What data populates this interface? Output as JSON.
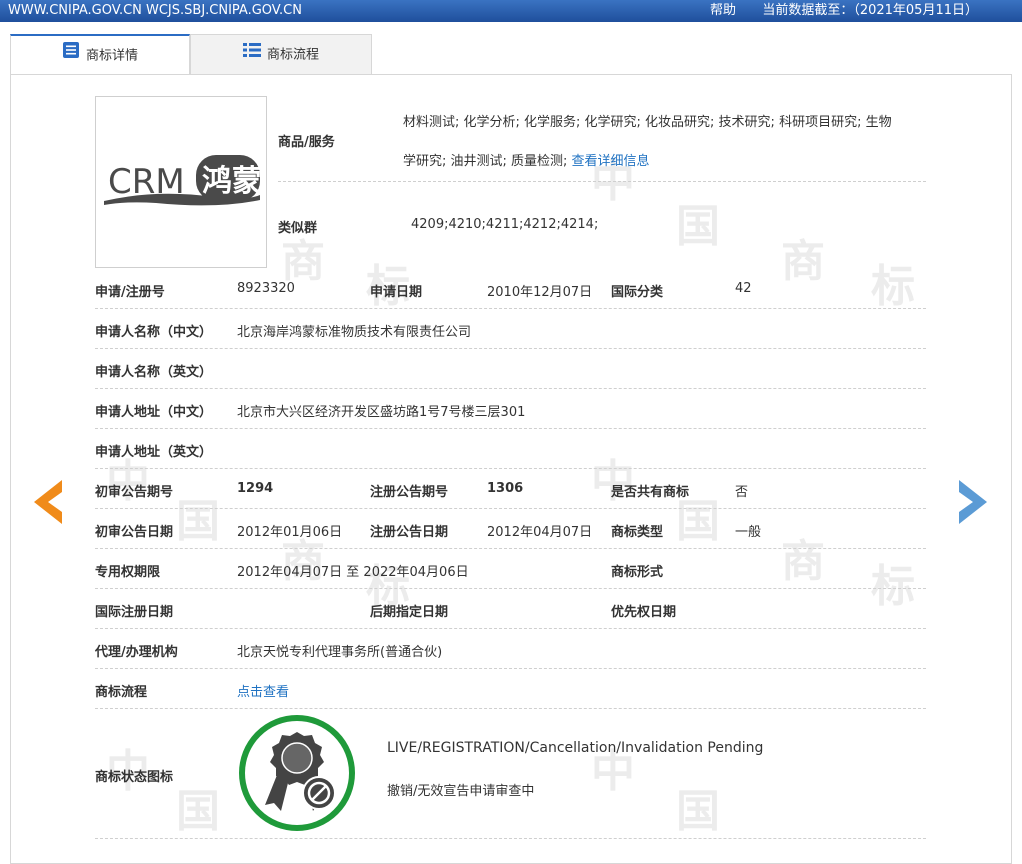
{
  "topbar": {
    "site": "WWW.CNIPA.GOV.CN WCJS.SBJ.CNIPA.GOV.CN",
    "help": "帮助",
    "data_date": "当前数据截至：（2021年05月11日）"
  },
  "tabs": [
    {
      "label": "商标详情",
      "icon": "list-icon",
      "active": true
    },
    {
      "label": "商标流程",
      "icon": "grid-list-icon",
      "active": false
    }
  ],
  "logo": {
    "text_latin": "CRM",
    "text_cn": "鸿蒙"
  },
  "goods": {
    "label": "商品/服务",
    "line1": "材料测试; 化学分析; 化学服务; 化学研究; 化妆品研究; 技术研究; 科研项目研究; 生物",
    "line2": "学研究; 油井测试; 质量检测;",
    "detail_link": "查看详细信息"
  },
  "similar": {
    "label": "类似群",
    "value": "4209;4210;4211;4212;4214;"
  },
  "rows": {
    "reg_no_label": "申请/注册号",
    "reg_no": "8923320",
    "app_date_label": "申请日期",
    "app_date": "2010年12月07日",
    "intl_class_label": "国际分类",
    "intl_class": "42",
    "applicant_cn_label": "申请人名称（中文）",
    "applicant_cn": "北京海岸鸿蒙标准物质技术有限责任公司",
    "applicant_en_label": "申请人名称（英文）",
    "address_cn_label": "申请人地址（中文）",
    "address_cn": "北京市大兴区经济开发区盛坊路1号7号楼三层301",
    "address_en_label": "申请人地址（英文）",
    "prelim_no_label": "初审公告期号",
    "prelim_no": "1294",
    "reg_pub_no_label": "注册公告期号",
    "reg_pub_no": "1306",
    "shared_label": "是否共有商标",
    "shared": "否",
    "prelim_date_label": "初审公告日期",
    "prelim_date": "2012年01月06日",
    "reg_pub_date_label": "注册公告日期",
    "reg_pub_date": "2012年04月07日",
    "mark_type_label": "商标类型",
    "mark_type": "一般",
    "term_label": "专用权期限",
    "term": "2012年04月07日 至 2022年04月06日",
    "mark_form_label": "商标形式",
    "intl_reg_date_label": "国际注册日期",
    "later_designation_label": "后期指定日期",
    "priority_date_label": "优先权日期",
    "agent_label": "代理/办理机构",
    "agent": "北京天悦专利代理事务所(普通合伙)",
    "process_label": "商标流程",
    "process_link": "点击查看",
    "status_label": "商标状态图标",
    "status_en": "LIVE/REGISTRATION/Cancellation/Invalidation Pending",
    "status_cn": "撤销/无效宣告申请审查中"
  },
  "watermark": [
    "中",
    "国",
    "商",
    "标"
  ],
  "colors": {
    "topbar": "#2a5fae",
    "link": "#1f72c2",
    "arrow_left": "#f08b1a",
    "arrow_right": "#5b9bd5",
    "status_ring": "#1f9a3a"
  }
}
